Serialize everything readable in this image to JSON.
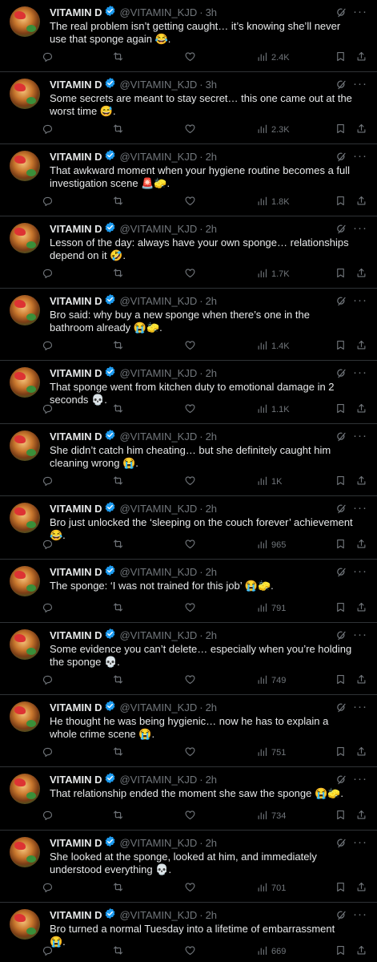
{
  "author": {
    "name": "VITAMIN D",
    "handle": "@VITAMIN_KJD"
  },
  "colors": {
    "background": "#000000",
    "text": "#e7e9ea",
    "muted": "#71767b",
    "verified": "#1d9bf0",
    "divider": "#2f3336"
  },
  "icons": [
    "verified-badge-icon",
    "grok-icon",
    "more-icon",
    "reply-icon",
    "retweet-icon",
    "like-icon",
    "views-icon",
    "bookmark-icon",
    "share-icon"
  ],
  "tweets": [
    {
      "time": "3h",
      "text": "The real problem isn’t getting caught… it’s knowing she’ll never use that sponge again 😂.",
      "views": "2.4K"
    },
    {
      "time": "3h",
      "text": "Some secrets are meant to stay secret… this one came out at the worst time 😅.",
      "views": "2.3K"
    },
    {
      "time": "2h",
      "text": "That awkward moment when your hygiene routine becomes a full investigation scene 🚨🧽.",
      "views": "1.8K"
    },
    {
      "time": "2h",
      "text": "Lesson of the day: always have your own sponge… relationships depend on it 🤣.",
      "views": "1.7K"
    },
    {
      "time": "2h",
      "text": "Bro said: why buy a new sponge when there’s one in the bathroom already 😭🧽.",
      "views": "1.4K"
    },
    {
      "time": "2h",
      "text": "That sponge went from kitchen duty to emotional damage in 2 seconds 💀.",
      "views": "1.1K"
    },
    {
      "time": "2h",
      "text": "She didn’t catch him cheating… but she definitely caught him cleaning wrong 😭.",
      "views": "1K"
    },
    {
      "time": "2h",
      "text": "Bro just unlocked the ‘sleeping on the couch forever’ achievement 😂.",
      "views": "965"
    },
    {
      "time": "2h",
      "text": "The sponge: ‘I was not trained for this job’ 😭🧽.",
      "views": "791"
    },
    {
      "time": "2h",
      "text": "Some evidence you can’t delete… especially when you’re holding the sponge 💀.",
      "views": "749"
    },
    {
      "time": "2h",
      "text": "He thought he was being hygienic… now he has to explain a whole crime scene 😭.",
      "views": "751"
    },
    {
      "time": "2h",
      "text": "That relationship ended the moment she saw the sponge 😭🧽.",
      "views": "734"
    },
    {
      "time": "2h",
      "text": "She looked at the sponge, looked at him, and immediately understood everything 💀.",
      "views": "701"
    },
    {
      "time": "2h",
      "text": "Bro turned a normal Tuesday into a lifetime of embarrassment 😭.",
      "views": "669"
    }
  ]
}
